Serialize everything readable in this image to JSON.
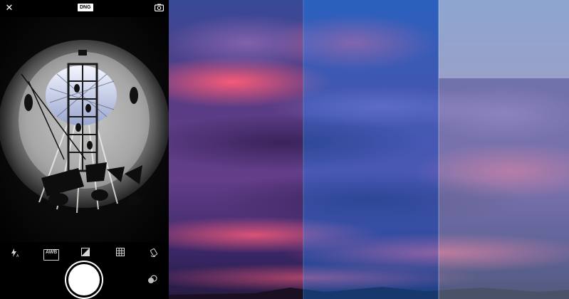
{
  "camera": {
    "close_icon": "close-icon",
    "format_badge": "DNG",
    "switch_camera_icon": "switch-camera-icon",
    "controls": {
      "flash": "flash-auto-icon",
      "white_balance": "AWB",
      "exposure": "exposure-icon",
      "grid": "grid-icon",
      "rotate": "rotate-icon"
    },
    "shutter": "shutter-button",
    "mode_toggle": "mode-toggle-icon"
  },
  "comparison_panels": [
    {
      "name": "sunset-panel-warm",
      "tint": "#ff5f6d"
    },
    {
      "name": "sunset-panel-blue",
      "tint": "#3aa0ff"
    },
    {
      "name": "sunset-panel-faded",
      "tint": "#9cc6e8"
    }
  ]
}
